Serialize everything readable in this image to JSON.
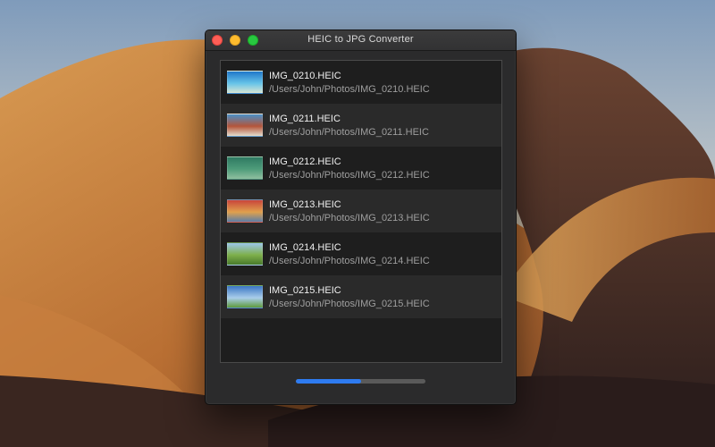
{
  "window": {
    "title": "HEIC to JPG Converter"
  },
  "files": [
    {
      "name": "IMG_0210.HEIC",
      "path": "/Users/John/Photos/IMG_0210.HEIC",
      "thumb_colors": [
        "#1f77c9",
        "#66c3e8",
        "#d9e6d4"
      ]
    },
    {
      "name": "IMG_0211.HEIC",
      "path": "/Users/John/Photos/IMG_0211.HEIC",
      "thumb_colors": [
        "#4a90c8",
        "#b4553a",
        "#e4dccd"
      ]
    },
    {
      "name": "IMG_0212.HEIC",
      "path": "/Users/John/Photos/IMG_0212.HEIC",
      "thumb_colors": [
        "#2f7a62",
        "#4e9c7a",
        "#8fbf9f"
      ]
    },
    {
      "name": "IMG_0213.HEIC",
      "path": "/Users/John/Photos/IMG_0213.HEIC",
      "thumb_colors": [
        "#c9453b",
        "#e0a04d",
        "#5b7ea8"
      ]
    },
    {
      "name": "IMG_0214.HEIC",
      "path": "/Users/John/Photos/IMG_0214.HEIC",
      "thumb_colors": [
        "#9cc6ea",
        "#7eb04b",
        "#497a2a"
      ]
    },
    {
      "name": "IMG_0215.HEIC",
      "path": "/Users/John/Photos/IMG_0215.HEIC",
      "thumb_colors": [
        "#3a76c4",
        "#a9cdea",
        "#5d9a3c"
      ]
    }
  ],
  "progress": {
    "fraction": 0.5,
    "color": "#2e7bf0"
  }
}
